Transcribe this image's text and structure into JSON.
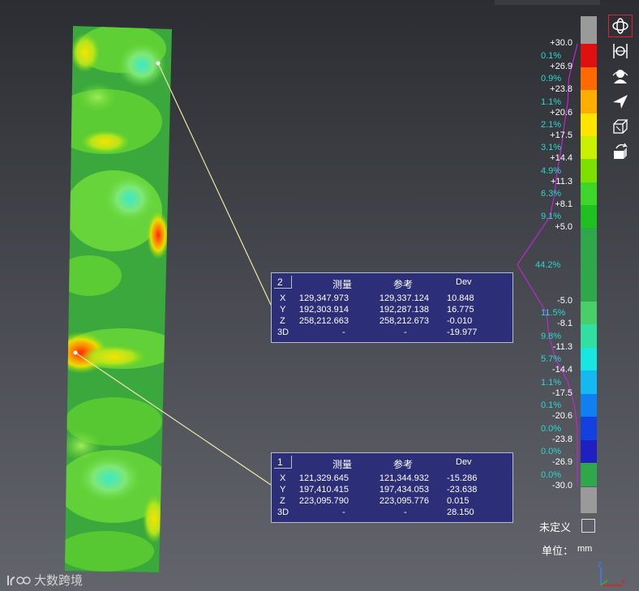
{
  "callouts": [
    {
      "id": "2",
      "headers": {
        "measured": "测量",
        "reference": "参考",
        "dev": "Dev"
      },
      "rows": [
        {
          "axis": "X",
          "measured": "129,347.973",
          "reference": "129,337.124",
          "dev": "10.848"
        },
        {
          "axis": "Y",
          "measured": "192,303.914",
          "reference": "192,287.138",
          "dev": "16.775"
        },
        {
          "axis": "Z",
          "measured": "258,212.663",
          "reference": "258,212.673",
          "dev": "-0.010"
        },
        {
          "axis": "3D",
          "measured": "-",
          "reference": "-",
          "dev": "-19.977"
        }
      ]
    },
    {
      "id": "1",
      "headers": {
        "measured": "测量",
        "reference": "参考",
        "dev": "Dev"
      },
      "rows": [
        {
          "axis": "X",
          "measured": "121,329.645",
          "reference": "121,344.932",
          "dev": "-15.286"
        },
        {
          "axis": "Y",
          "measured": "197,410.415",
          "reference": "197,434.053",
          "dev": "-23.638"
        },
        {
          "axis": "Z",
          "measured": "223,095.790",
          "reference": "223,095.776",
          "dev": "0.015"
        },
        {
          "axis": "3D",
          "measured": "-",
          "reference": "-",
          "dev": "28.150"
        }
      ]
    }
  ],
  "scale": {
    "values": [
      "+30.0",
      "+26.9",
      "+23.8",
      "+20.6",
      "+17.5",
      "+14.4",
      "+11.3",
      "+8.1",
      "+5.0",
      "-5.0",
      "-8.1",
      "-11.3",
      "-14.4",
      "-17.5",
      "-20.6",
      "-23.8",
      "-26.9",
      "-30.0"
    ],
    "percentages": [
      "0.1%",
      "0.9%",
      "1.1%",
      "2.1%",
      "3.1%",
      "4.9%",
      "6.3%",
      "9.1%",
      "44.2%",
      "11.5%",
      "9.8%",
      "5.7%",
      "1.1%",
      "0.1%",
      "0.0%",
      "0.0%",
      "0.0%"
    ],
    "colors": [
      "#e01010",
      "#ff6a00",
      "#ffae00",
      "#ffe400",
      "#c8f000",
      "#7ee000",
      "#3fd62a",
      "#1fc01f",
      "#2ea84a",
      "#4ace6a",
      "#31e0a0",
      "#18e6e0",
      "#15b8f0",
      "#1080f0",
      "#1440e0",
      "#2020c0"
    ],
    "undefined_label": "未定义",
    "unit_label": "单位：",
    "unit_value": "mm",
    "histogram_color": "#c026d3"
  },
  "toolbar": {
    "tools": [
      {
        "name": "rotate-view-icon",
        "active": true
      },
      {
        "name": "fit-view-icon",
        "active": false
      },
      {
        "name": "user-view-icon",
        "active": false
      },
      {
        "name": "direction-arrow-icon",
        "active": false
      },
      {
        "name": "cube-view-icon",
        "active": false
      },
      {
        "name": "box-arrow-icon",
        "active": false
      }
    ]
  },
  "watermark": {
    "text": "大数跨境"
  },
  "axis": {
    "x": "x",
    "z": "z"
  }
}
